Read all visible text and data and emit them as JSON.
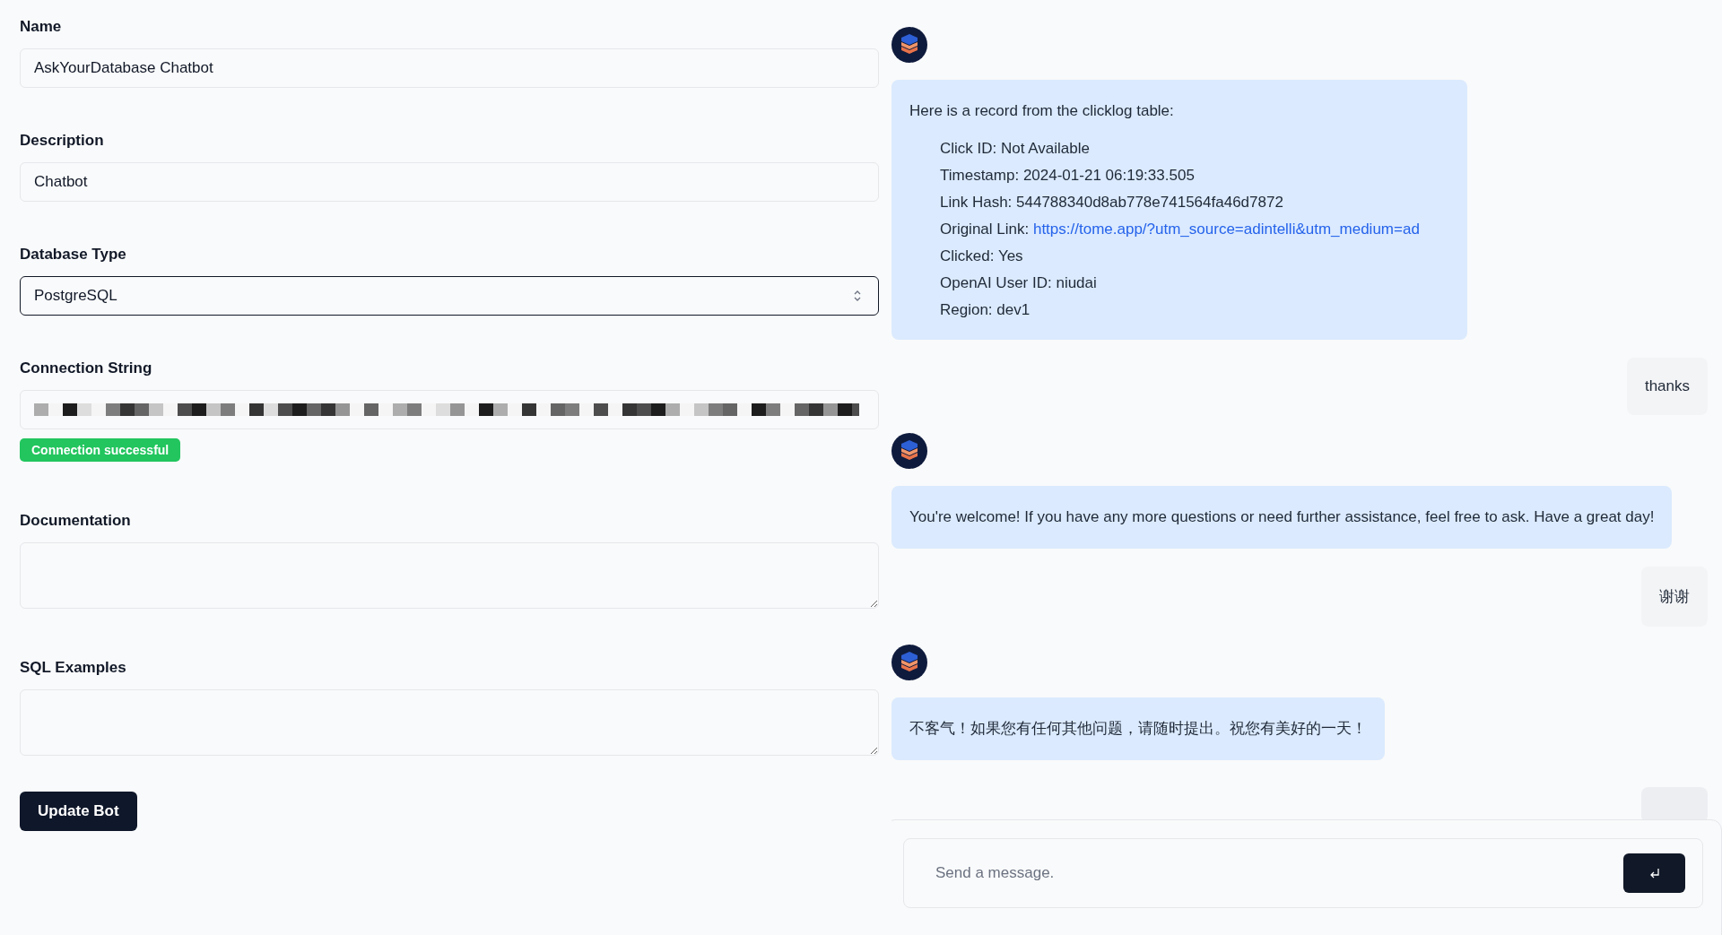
{
  "form": {
    "fields": [
      {
        "kind": "text",
        "label": "Name",
        "value": "AskYourDatabase Chatbot"
      },
      {
        "kind": "text",
        "label": "Description",
        "value": "Chatbot"
      },
      {
        "kind": "select",
        "label": "Database Type",
        "value": "PostgreSQL"
      },
      {
        "kind": "redacted",
        "label": "Connection String",
        "badge": "Connection successful"
      },
      {
        "kind": "textarea",
        "label": "Documentation"
      },
      {
        "kind": "textarea",
        "label": "SQL Examples"
      }
    ],
    "submit": "Update Bot"
  },
  "chat": {
    "messages": [
      {
        "kind": "bot",
        "intro": "Here is a record from the clicklog table:",
        "fields": [
          {
            "label": "Click ID:",
            "value": "Not Available"
          },
          {
            "label": "Timestamp:",
            "value": "2024-01-21 06:19:33.505"
          },
          {
            "label": "Link Hash:",
            "value": "544788340d8ab778e741564fa46d7872"
          },
          {
            "label": "Original Link:",
            "link": "https://tome.app/?utm_source=adintelli&utm_medium=ad"
          },
          {
            "label": "Clicked:",
            "value": "Yes"
          },
          {
            "label": "OpenAI User ID:",
            "value": "niudai"
          },
          {
            "label": "Region:",
            "value": "dev1"
          }
        ]
      },
      {
        "kind": "user",
        "text": "thanks"
      },
      {
        "kind": "bot",
        "text": "You're welcome! If you have any more questions or need further assistance, feel free to ask. Have a great day!"
      },
      {
        "kind": "user",
        "text": "谢谢"
      },
      {
        "kind": "bot",
        "text": "不客气！如果您有任何其他问题，请随时提出。祝您有美好的一天！"
      },
      {
        "kind": "user"
      }
    ],
    "input": {
      "placeholder": "Send a message."
    }
  }
}
